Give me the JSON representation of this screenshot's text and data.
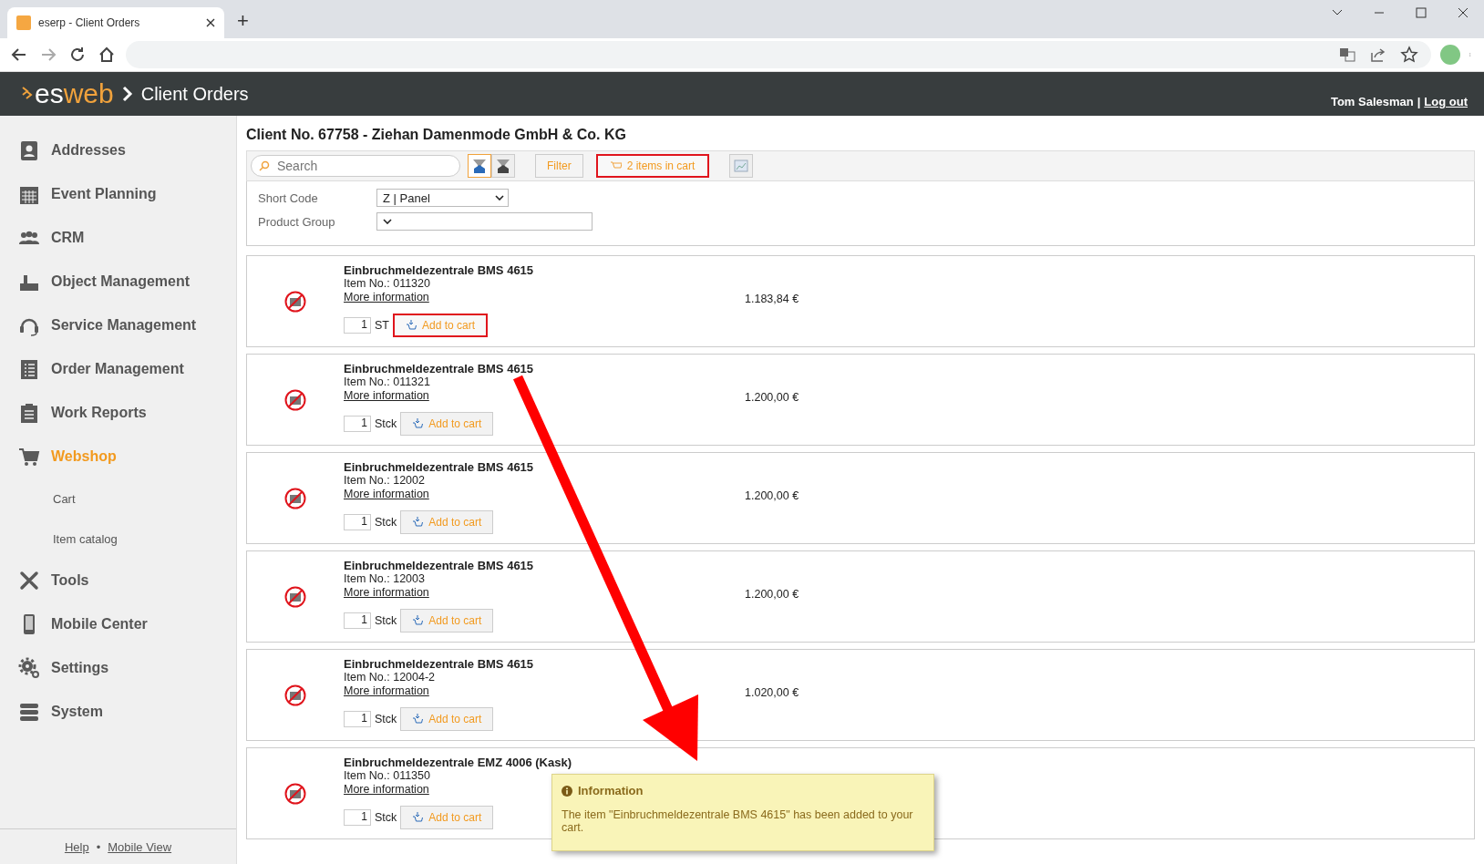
{
  "browser": {
    "tab_title": "eserp - Client Orders",
    "new_tab": "+"
  },
  "header": {
    "logo_left": "es",
    "logo_right": "web",
    "title": "Client Orders",
    "user": "Tom Salesman",
    "separator": "|",
    "logout": "Log out"
  },
  "sidebar": {
    "items": [
      {
        "label": "Addresses",
        "selected": false
      },
      {
        "label": "Event Planning",
        "selected": false
      },
      {
        "label": "CRM",
        "selected": false
      },
      {
        "label": "Object Management",
        "selected": false
      },
      {
        "label": "Service Management",
        "selected": false
      },
      {
        "label": "Order Management",
        "selected": false
      },
      {
        "label": "Work Reports",
        "selected": false
      },
      {
        "label": "Webshop",
        "selected": true,
        "children": [
          {
            "label": "Cart",
            "selected": false
          },
          {
            "label": "Item catalog",
            "selected": false
          }
        ]
      },
      {
        "label": "Tools",
        "selected": false
      },
      {
        "label": "Mobile Center",
        "selected": false
      },
      {
        "label": "Settings",
        "selected": false
      },
      {
        "label": "System",
        "selected": false
      }
    ],
    "footer": {
      "help": "Help",
      "dot": "•",
      "mobile_view": "Mobile View"
    }
  },
  "client_title": "Client No. 67758 - Ziehan Damenmode GmbH & Co. KG",
  "toolbar": {
    "search_placeholder": "Search",
    "filter": "Filter",
    "cart": "2 items in cart",
    "cart_highlighted": true
  },
  "filters": [
    {
      "label": "Short Code",
      "value": "Z | Panel"
    },
    {
      "label": "Product Group"
    }
  ],
  "products": [
    {
      "name": "Einbruchmeldezentrale BMS 4615",
      "item_no": "Item No.: 011320",
      "more": "More information",
      "qty": "1",
      "unit": "ST",
      "button": "Add to cart",
      "price": "1.183,84 €",
      "highlighted": true
    },
    {
      "name": "Einbruchmeldezentrale BMS 4615",
      "item_no": "Item No.: 011321",
      "more": "More information",
      "qty": "1",
      "unit": "Stck",
      "button": "Add to cart",
      "price": "1.200,00 €",
      "highlighted": false
    },
    {
      "name": "Einbruchmeldezentrale BMS 4615",
      "item_no": "Item No.: 12002",
      "more": "More information",
      "qty": "1",
      "unit": "Stck",
      "button": "Add to cart",
      "price": "1.200,00 €",
      "highlighted": false
    },
    {
      "name": "Einbruchmeldezentrale BMS 4615",
      "item_no": "Item No.: 12003",
      "more": "More information",
      "qty": "1",
      "unit": "Stck",
      "button": "Add to cart",
      "price": "1.200,00 €",
      "highlighted": false
    },
    {
      "name": "Einbruchmeldezentrale BMS 4615",
      "item_no": "Item No.: 12004-2",
      "more": "More information",
      "qty": "1",
      "unit": "Stck",
      "button": "Add to cart",
      "price": "1.020,00 €",
      "highlighted": false
    },
    {
      "name": "Einbruchmeldezentrale EMZ 4006 (Kask)",
      "item_no": "Item No.: 011350",
      "more": "More information",
      "qty": "1",
      "unit": "Stck",
      "button": "Add to cart",
      "highlighted": false
    }
  ],
  "notification": {
    "title": "Information",
    "message": "The item \"Einbruchmeldezentrale BMS 4615\" has been added to your cart."
  }
}
